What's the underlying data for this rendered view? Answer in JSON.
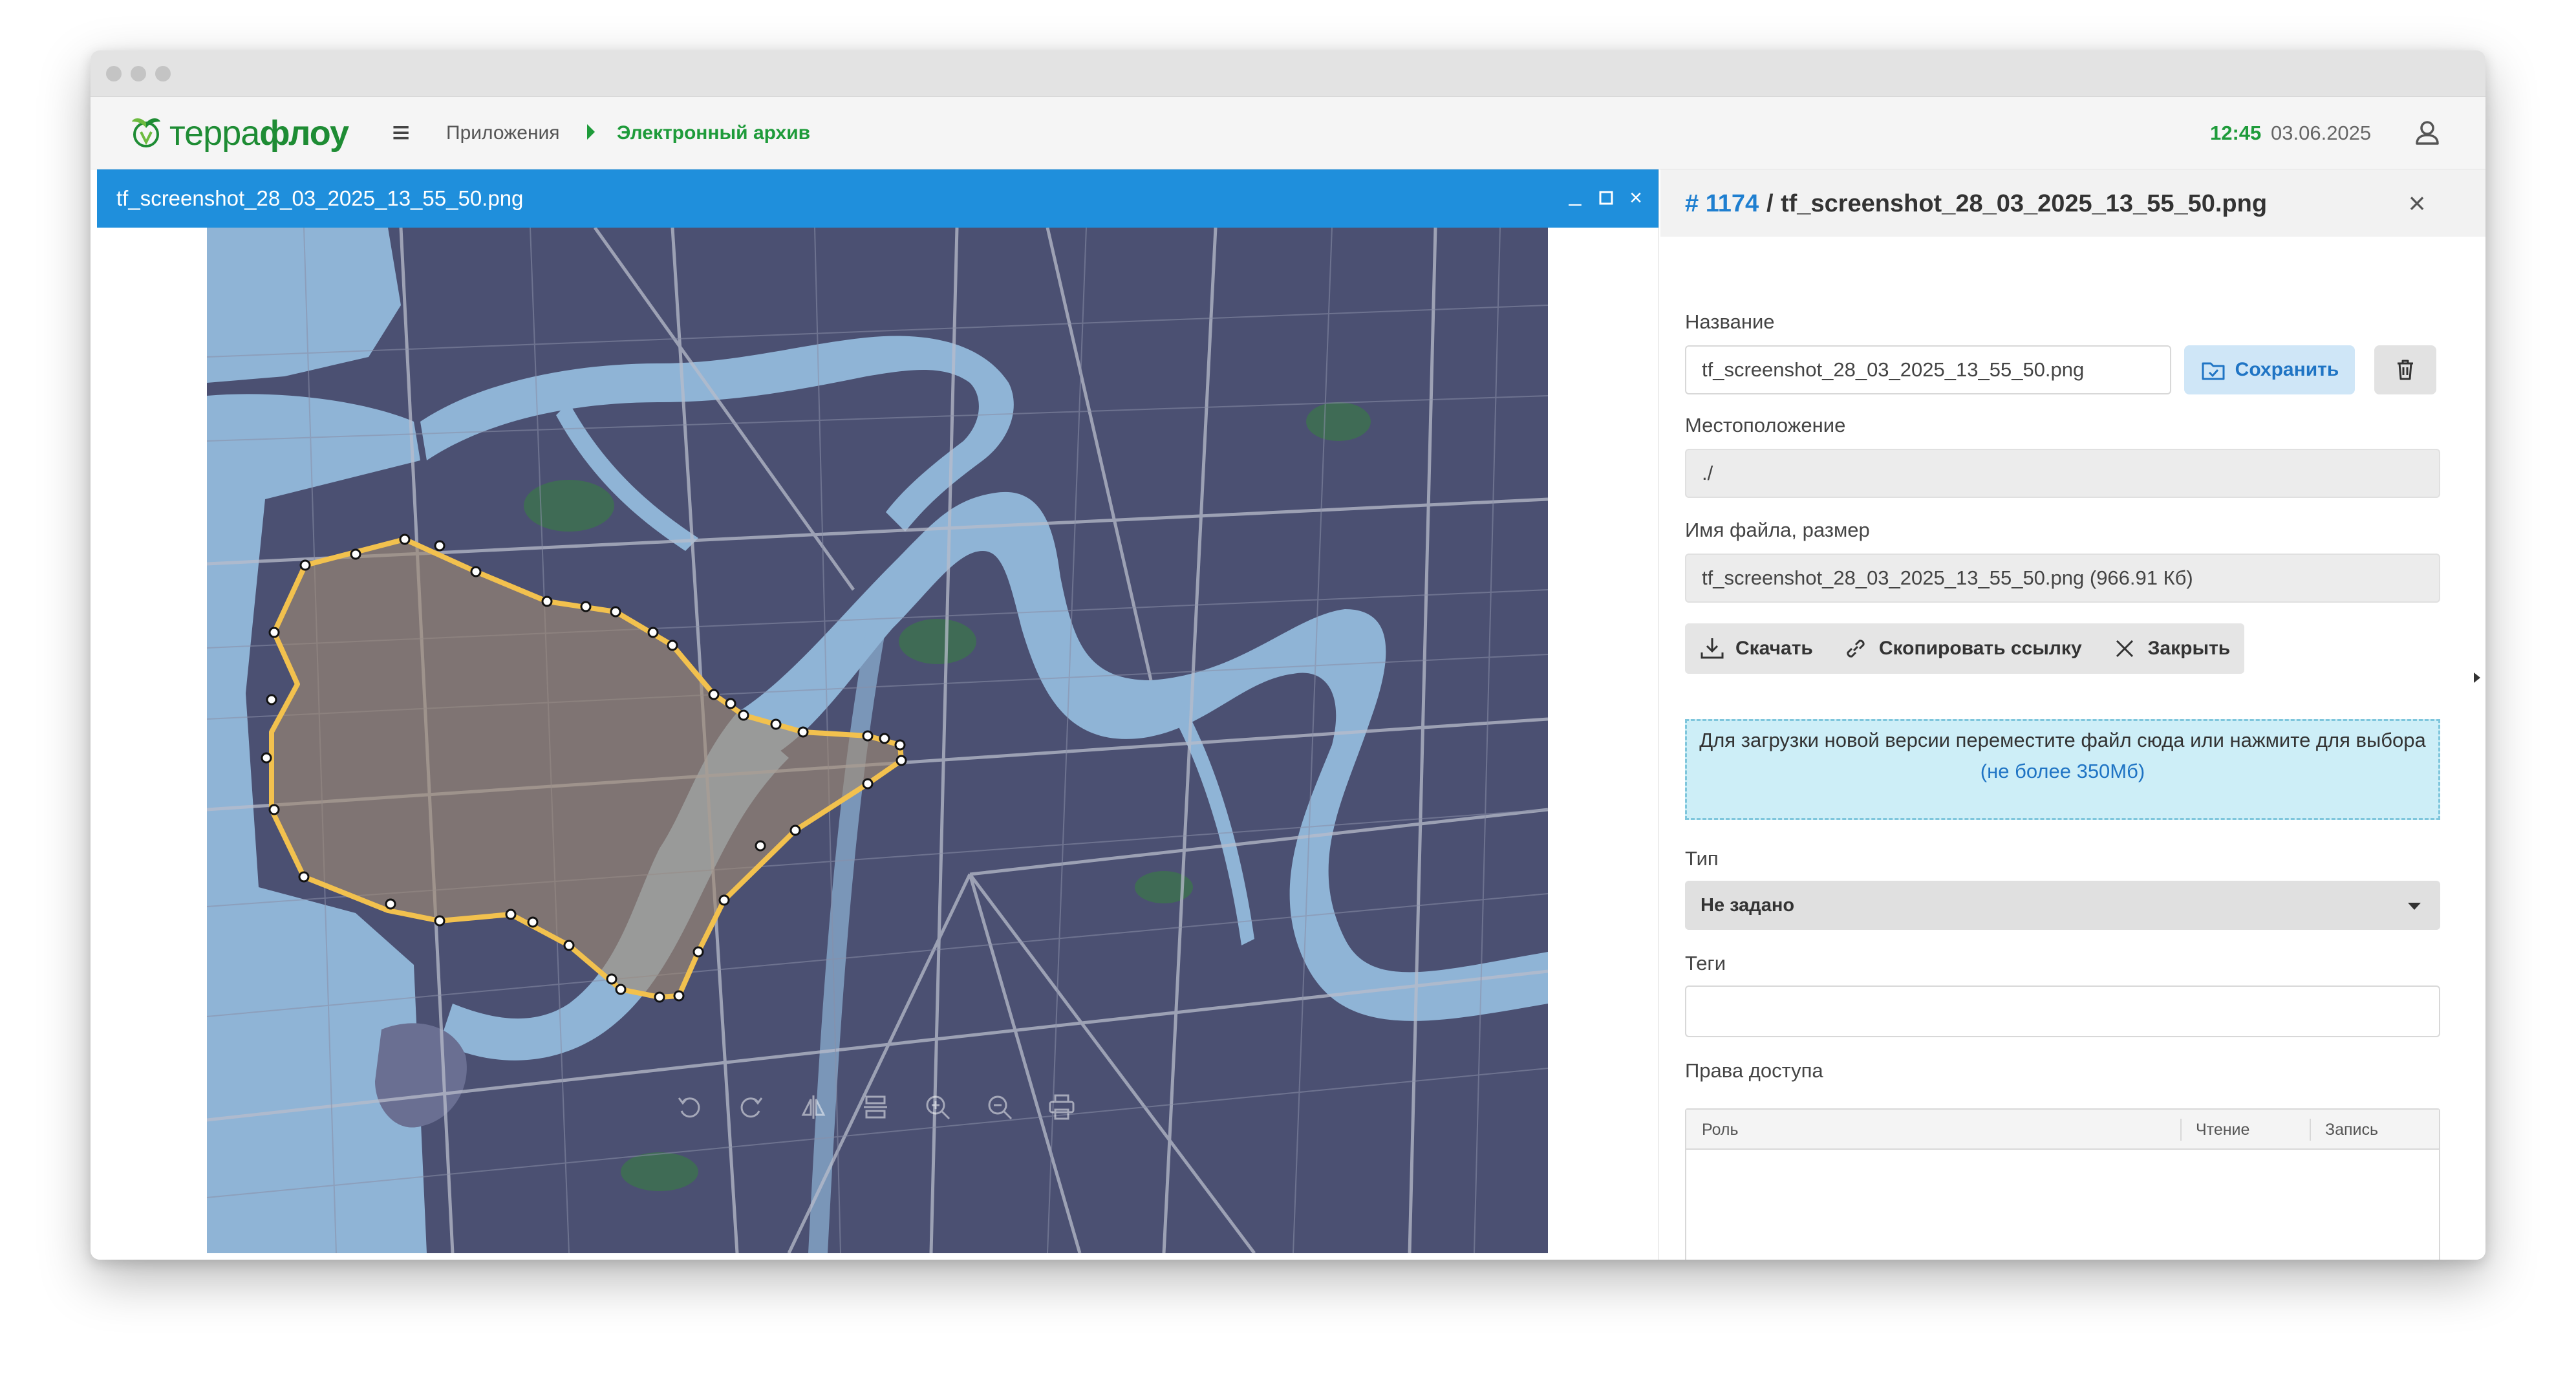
{
  "header": {
    "logo_part1": "терра",
    "logo_part2": "флоу",
    "menu_icon": "hamburger-menu-icon",
    "breadcrumb_apps": "Приложения",
    "breadcrumb_archive": "Электронный архив",
    "time": "12:45",
    "date": "03.06.2025",
    "user_icon": "user-icon"
  },
  "viewer": {
    "title": "tf_screenshot_28_03_2025_13_55_50.png",
    "window_buttons": [
      "minimize-icon",
      "maximize-icon",
      "close-icon"
    ],
    "toolbar_icons": [
      "rotate-left-icon",
      "rotate-right-icon",
      "flip-horizontal-icon",
      "flip-vertical-icon",
      "zoom-in-icon",
      "zoom-out-icon",
      "print-icon"
    ]
  },
  "panel": {
    "id": "# 1174",
    "separator": "/",
    "title": "tf_screenshot_28_03_2025_13_55_50.png",
    "name_label": "Название",
    "name_value": "tf_screenshot_28_03_2025_13_55_50.png",
    "save_label": "Сохранить",
    "location_label": "Местоположение",
    "location_value": "./",
    "filename_label": "Имя файла, размер",
    "filename_value": "tf_screenshot_28_03_2025_13_55_50.png (966.91 Кб)",
    "download_label": "Скачать",
    "copy_link_label": "Скопировать ссылку",
    "close_label": "Закрыть",
    "dropzone_text": "Для загрузки новой версии переместите файл сюда или нажмите для выбора",
    "dropzone_limit": "(не более 350Мб)",
    "type_label": "Тип",
    "type_value": "Не задано",
    "tags_label": "Теги",
    "tags_value": "",
    "rights_label": "Права доступа",
    "rights_columns": [
      "Роль",
      "Чтение",
      "Запись"
    ]
  },
  "colors": {
    "accent_blue": "#1f8fdc",
    "brand_green": "#1e9b3a",
    "map_water": "#8fb4d6",
    "map_land": "#4b5072",
    "selection_outline": "#f2c14e"
  }
}
